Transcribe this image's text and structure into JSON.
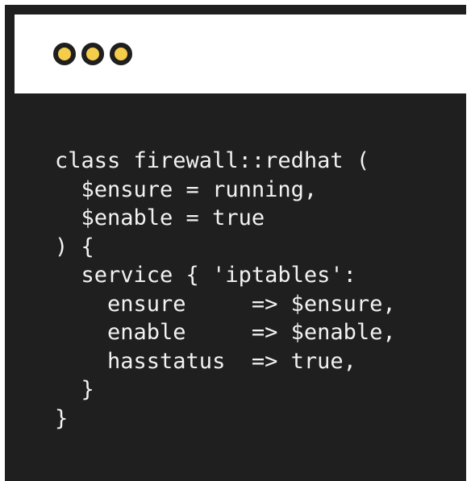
{
  "window": {
    "controls": [
      {
        "name": "window-dot-1",
        "icon": "circle-icon",
        "color": "#f5cd4b"
      },
      {
        "name": "window-dot-2",
        "icon": "circle-icon",
        "color": "#f5cd4b"
      },
      {
        "name": "window-dot-3",
        "icon": "circle-icon",
        "color": "#f5cd4b"
      }
    ],
    "background": "#1f1f1f",
    "titlebar_background": "#ffffff"
  },
  "code": {
    "language": "puppet",
    "lines": [
      "class firewall::redhat (",
      "  $ensure = running,",
      "  $enable = true",
      ") {",
      "  service { 'iptables':",
      "    ensure     => $ensure,",
      "    enable     => $enable,",
      "    hasstatus  => true,",
      "  }",
      "}"
    ],
    "text_color": "#f2f2f2"
  }
}
